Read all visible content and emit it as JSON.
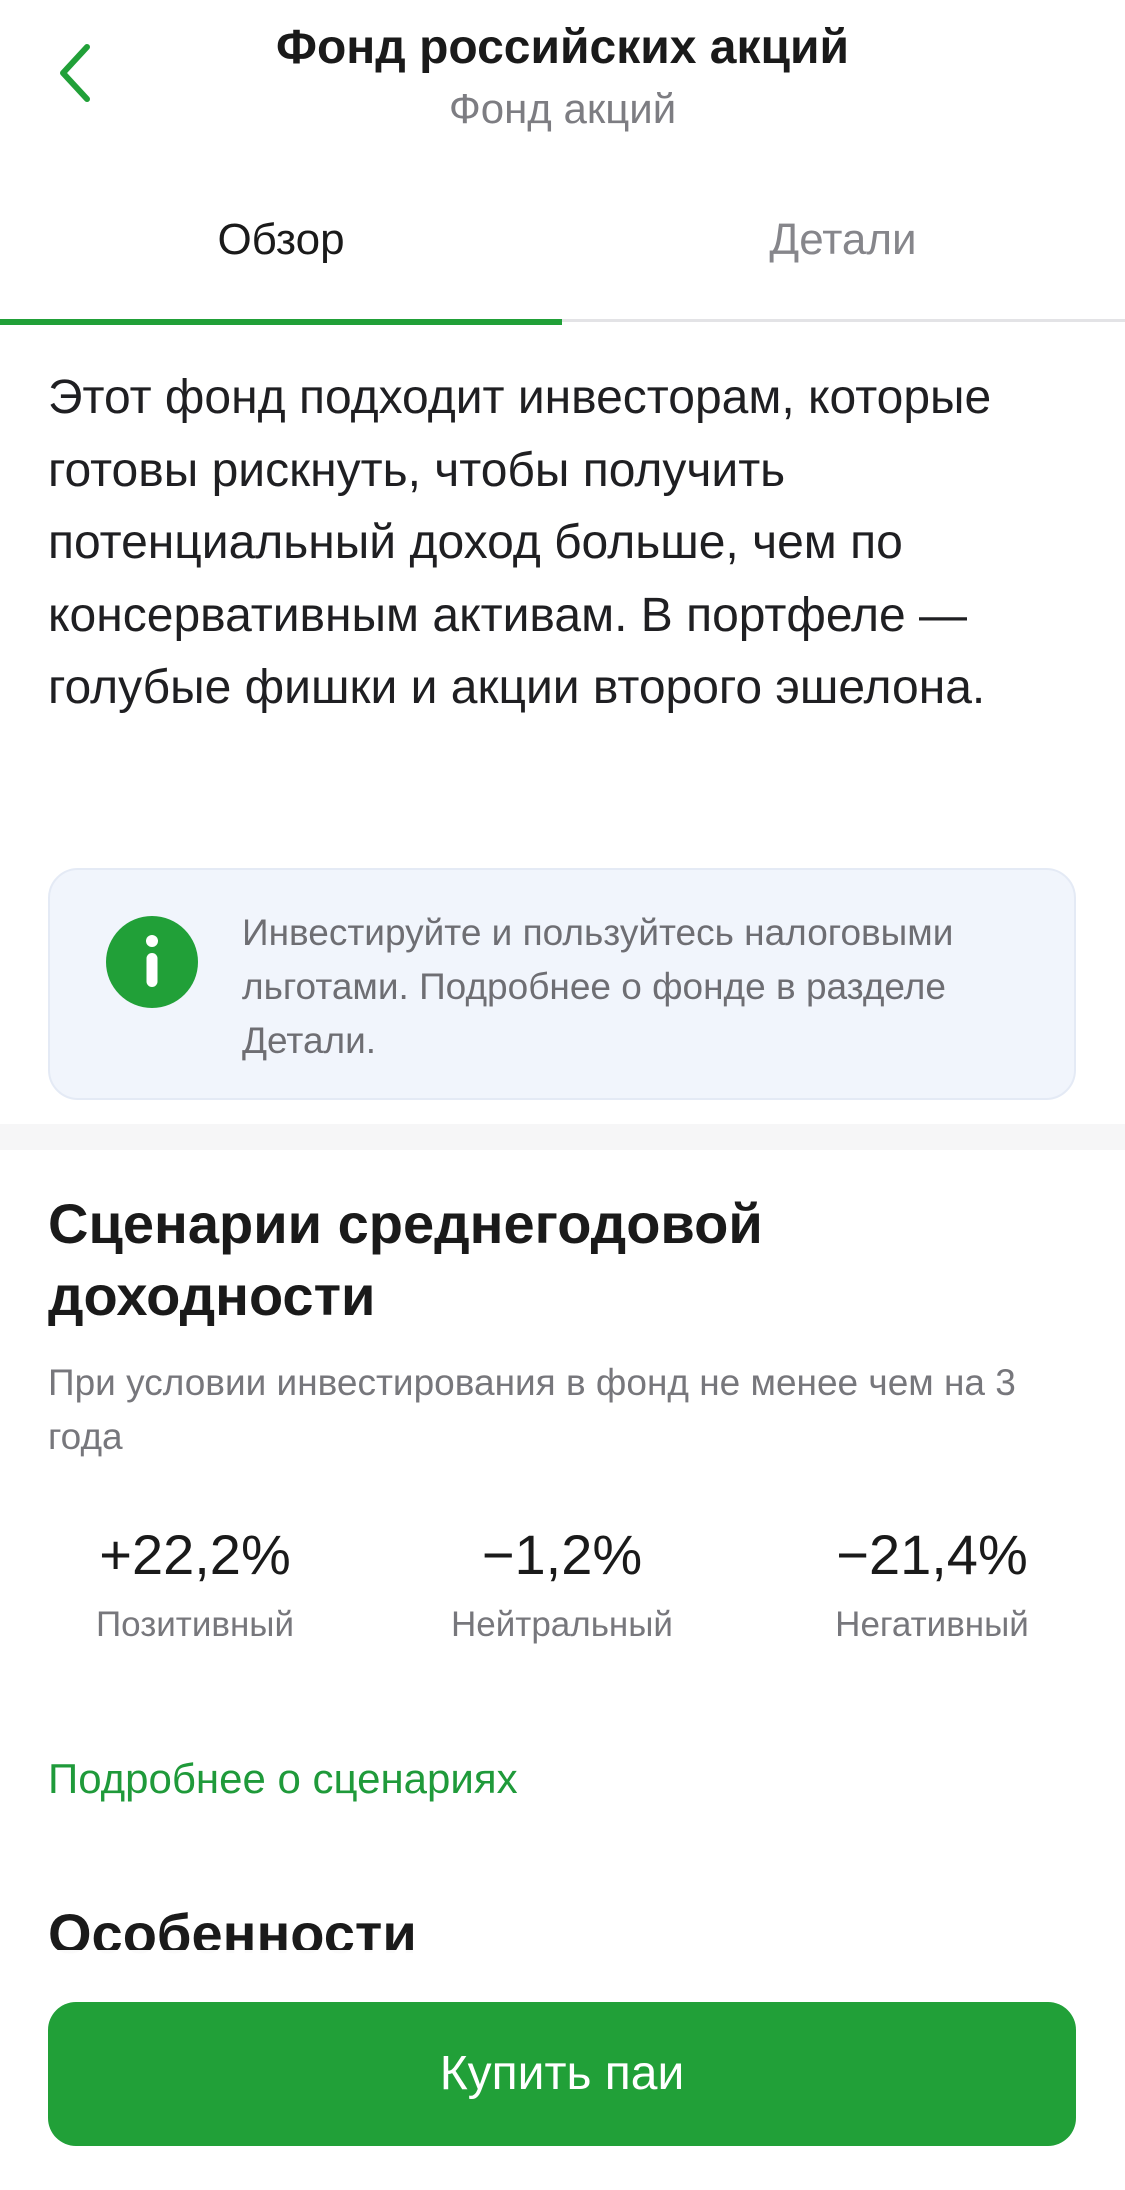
{
  "header": {
    "title": "Фонд российских акций",
    "subtitle": "Фонд акций",
    "back_icon": "chevron-left-icon"
  },
  "tabs": [
    {
      "label": "Обзор",
      "active": true
    },
    {
      "label": "Детали",
      "active": false
    }
  ],
  "overview": {
    "description": "Этот фонд подходит инвесторам, которые готовы рискнуть, чтобы получить потенциальный доход больше, чем по консервативным активам. В портфеле — голубые фишки и акции второго эшелона.",
    "info_card": {
      "icon": "info-icon",
      "text": "Инвестируйте и пользуйтесь налоговыми льготами. Подробнее о фонде в разделе Детали."
    },
    "scenarios": {
      "title": "Сценарии среднегодовой доходности",
      "subtitle": "При условии инвестирования в фонд не менее чем на 3 года",
      "items": [
        {
          "value": "+22,2%",
          "label": "Позитивный"
        },
        {
          "value": "−1,2%",
          "label": "Нейтральный"
        },
        {
          "value": "−21,4%",
          "label": "Негативный"
        }
      ],
      "more_link": "Подробнее о сценариях"
    },
    "features_title": "Особенности"
  },
  "actions": {
    "buy_label": "Купить паи"
  },
  "colors": {
    "accent": "#21a038",
    "link": "#1f9a3a",
    "info_bg": "#f1f5fc"
  }
}
